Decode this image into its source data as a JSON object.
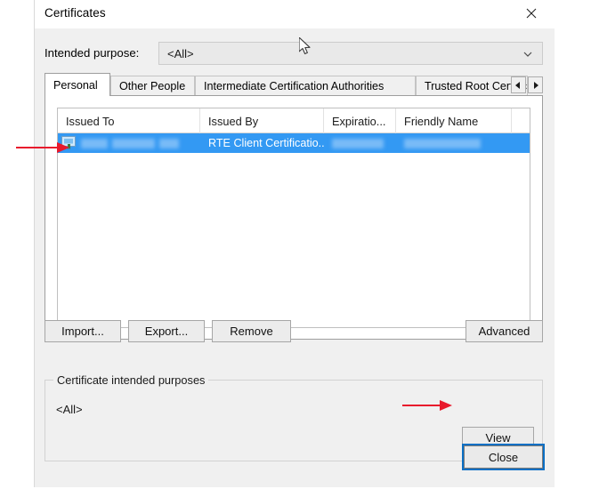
{
  "window": {
    "title": "Certificates",
    "close_icon": "close-x-icon"
  },
  "purpose": {
    "label": "Intended purpose:",
    "value": "<All>",
    "chevron_icon": "chevron-down-icon"
  },
  "tabs": {
    "items": [
      {
        "label": "Personal",
        "active": true
      },
      {
        "label": "Other People",
        "active": false
      },
      {
        "label": "Intermediate Certification Authorities",
        "active": false
      },
      {
        "label": "Trusted Root Certification",
        "active": false
      }
    ],
    "scroll_left_icon": "triangle-left-icon",
    "scroll_right_icon": "triangle-right-icon"
  },
  "list": {
    "columns": [
      "Issued To",
      "Issued By",
      "Expiratio...",
      "Friendly Name"
    ],
    "rows": [
      {
        "icon": "certificate-icon",
        "issued_to": "",
        "issued_by": "RTE Client Certificatio...",
        "expiration": "",
        "friendly_name": "",
        "selected": true,
        "redacted": [
          "issued_to",
          "expiration",
          "friendly_name"
        ]
      }
    ]
  },
  "actions": {
    "import": "Import...",
    "export": "Export...",
    "remove": "Remove",
    "advanced": "Advanced"
  },
  "purposes_group": {
    "title": "Certificate intended purposes",
    "value": "<All>",
    "view": "View"
  },
  "footer": {
    "close": "Close"
  },
  "annotations": {
    "arrow_color": "#e8192c",
    "arrow_row_label": "arrow-pointing-to-selected-row",
    "arrow_view_label": "arrow-pointing-to-view-button"
  }
}
